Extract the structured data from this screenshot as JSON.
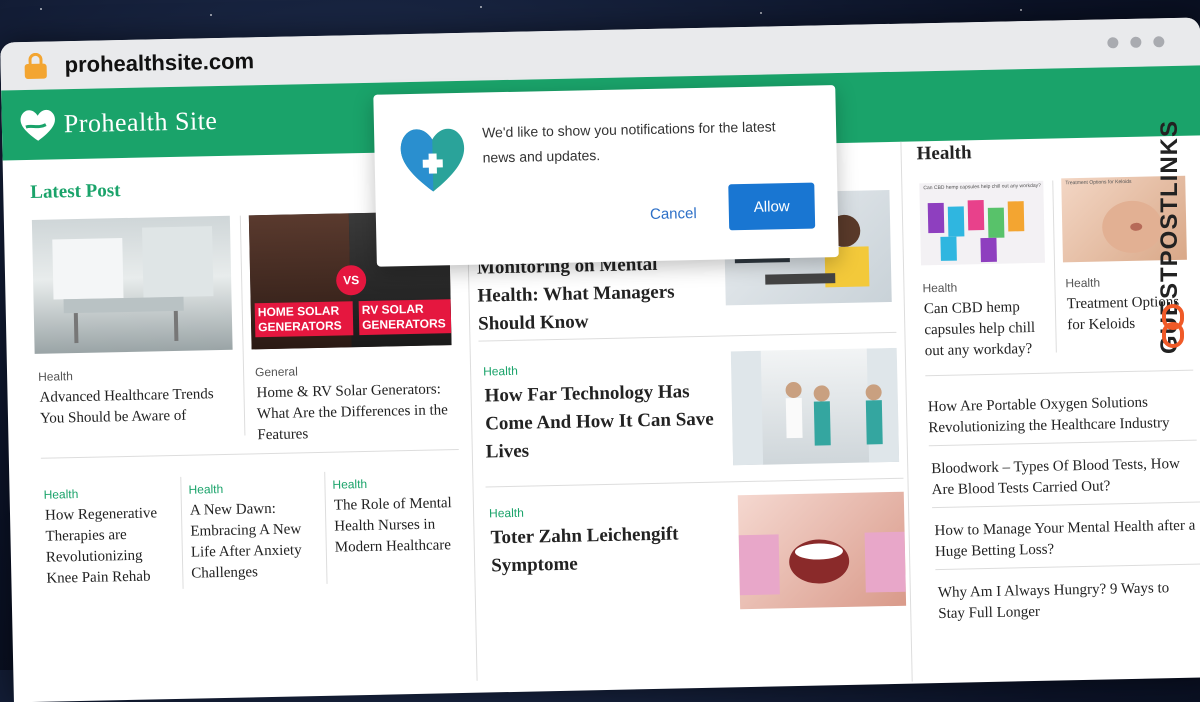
{
  "browser": {
    "url": "prohealthsite.com"
  },
  "site": {
    "logo_text": "Prohealth Site"
  },
  "popup": {
    "message": "We'd like to show you notifications for the latest news and updates.",
    "cancel_label": "Cancel",
    "allow_label": "Allow"
  },
  "latest": {
    "title": "Latest Post",
    "cards": [
      {
        "category": "Health",
        "title": "Advanced Healthcare Trends You Should be Aware of"
      },
      {
        "category": "General",
        "title": "Home & RV Solar Generators: What Are the Differences in the Features",
        "thumb_text_left": "HOME SOLAR GENERATORS",
        "thumb_text_right": "RV SOLAR GENERATORS",
        "thumb_vs": "VS"
      }
    ],
    "small": [
      {
        "category": "Health",
        "title": "How Regenerative Therapies are Revolutionizing Knee Pain Rehab"
      },
      {
        "category": "Health",
        "title": "A New Dawn: Embracing A New Life After Anxiety Challenges"
      },
      {
        "category": "Health",
        "title": "The Role of Mental Health Nurses in Modern Healthcare"
      }
    ]
  },
  "middle": [
    {
      "category": "",
      "title": "The Impact of Employee Monitoring on Mental Health: What Managers Should Know"
    },
    {
      "category": "Health",
      "title": "How Far Technology Has Come And How It Can Save Lives"
    },
    {
      "category": "Health",
      "title": "Toter Zahn Leichengift Symptome"
    }
  ],
  "sidebar": {
    "title": "Health",
    "cards": [
      {
        "category": "Health",
        "title": "Can CBD hemp capsules help chill out any workday?",
        "thumb_caption": "Can CBD hemp capsules help chill out any workday?"
      },
      {
        "category": "Health",
        "title": "Treatment Options for Keloids",
        "thumb_caption": "Treatment Options for Keloids"
      }
    ],
    "links": [
      "How Are Portable Oxygen Solutions Revolutionizing the Healthcare Industry",
      "Bloodwork – Types Of Blood Tests, How Are Blood Tests Carried Out?",
      "How to Manage Your Mental Health after a Huge Betting Loss?",
      "Why Am I Always Hungry? 9 Ways to Stay Full Longer"
    ]
  },
  "watermark": {
    "text": "GUESTPOSTLINKS"
  },
  "colors": {
    "brand_green": "#1aa36a",
    "allow_blue": "#1976d2",
    "lock_orange": "#f3a531"
  }
}
